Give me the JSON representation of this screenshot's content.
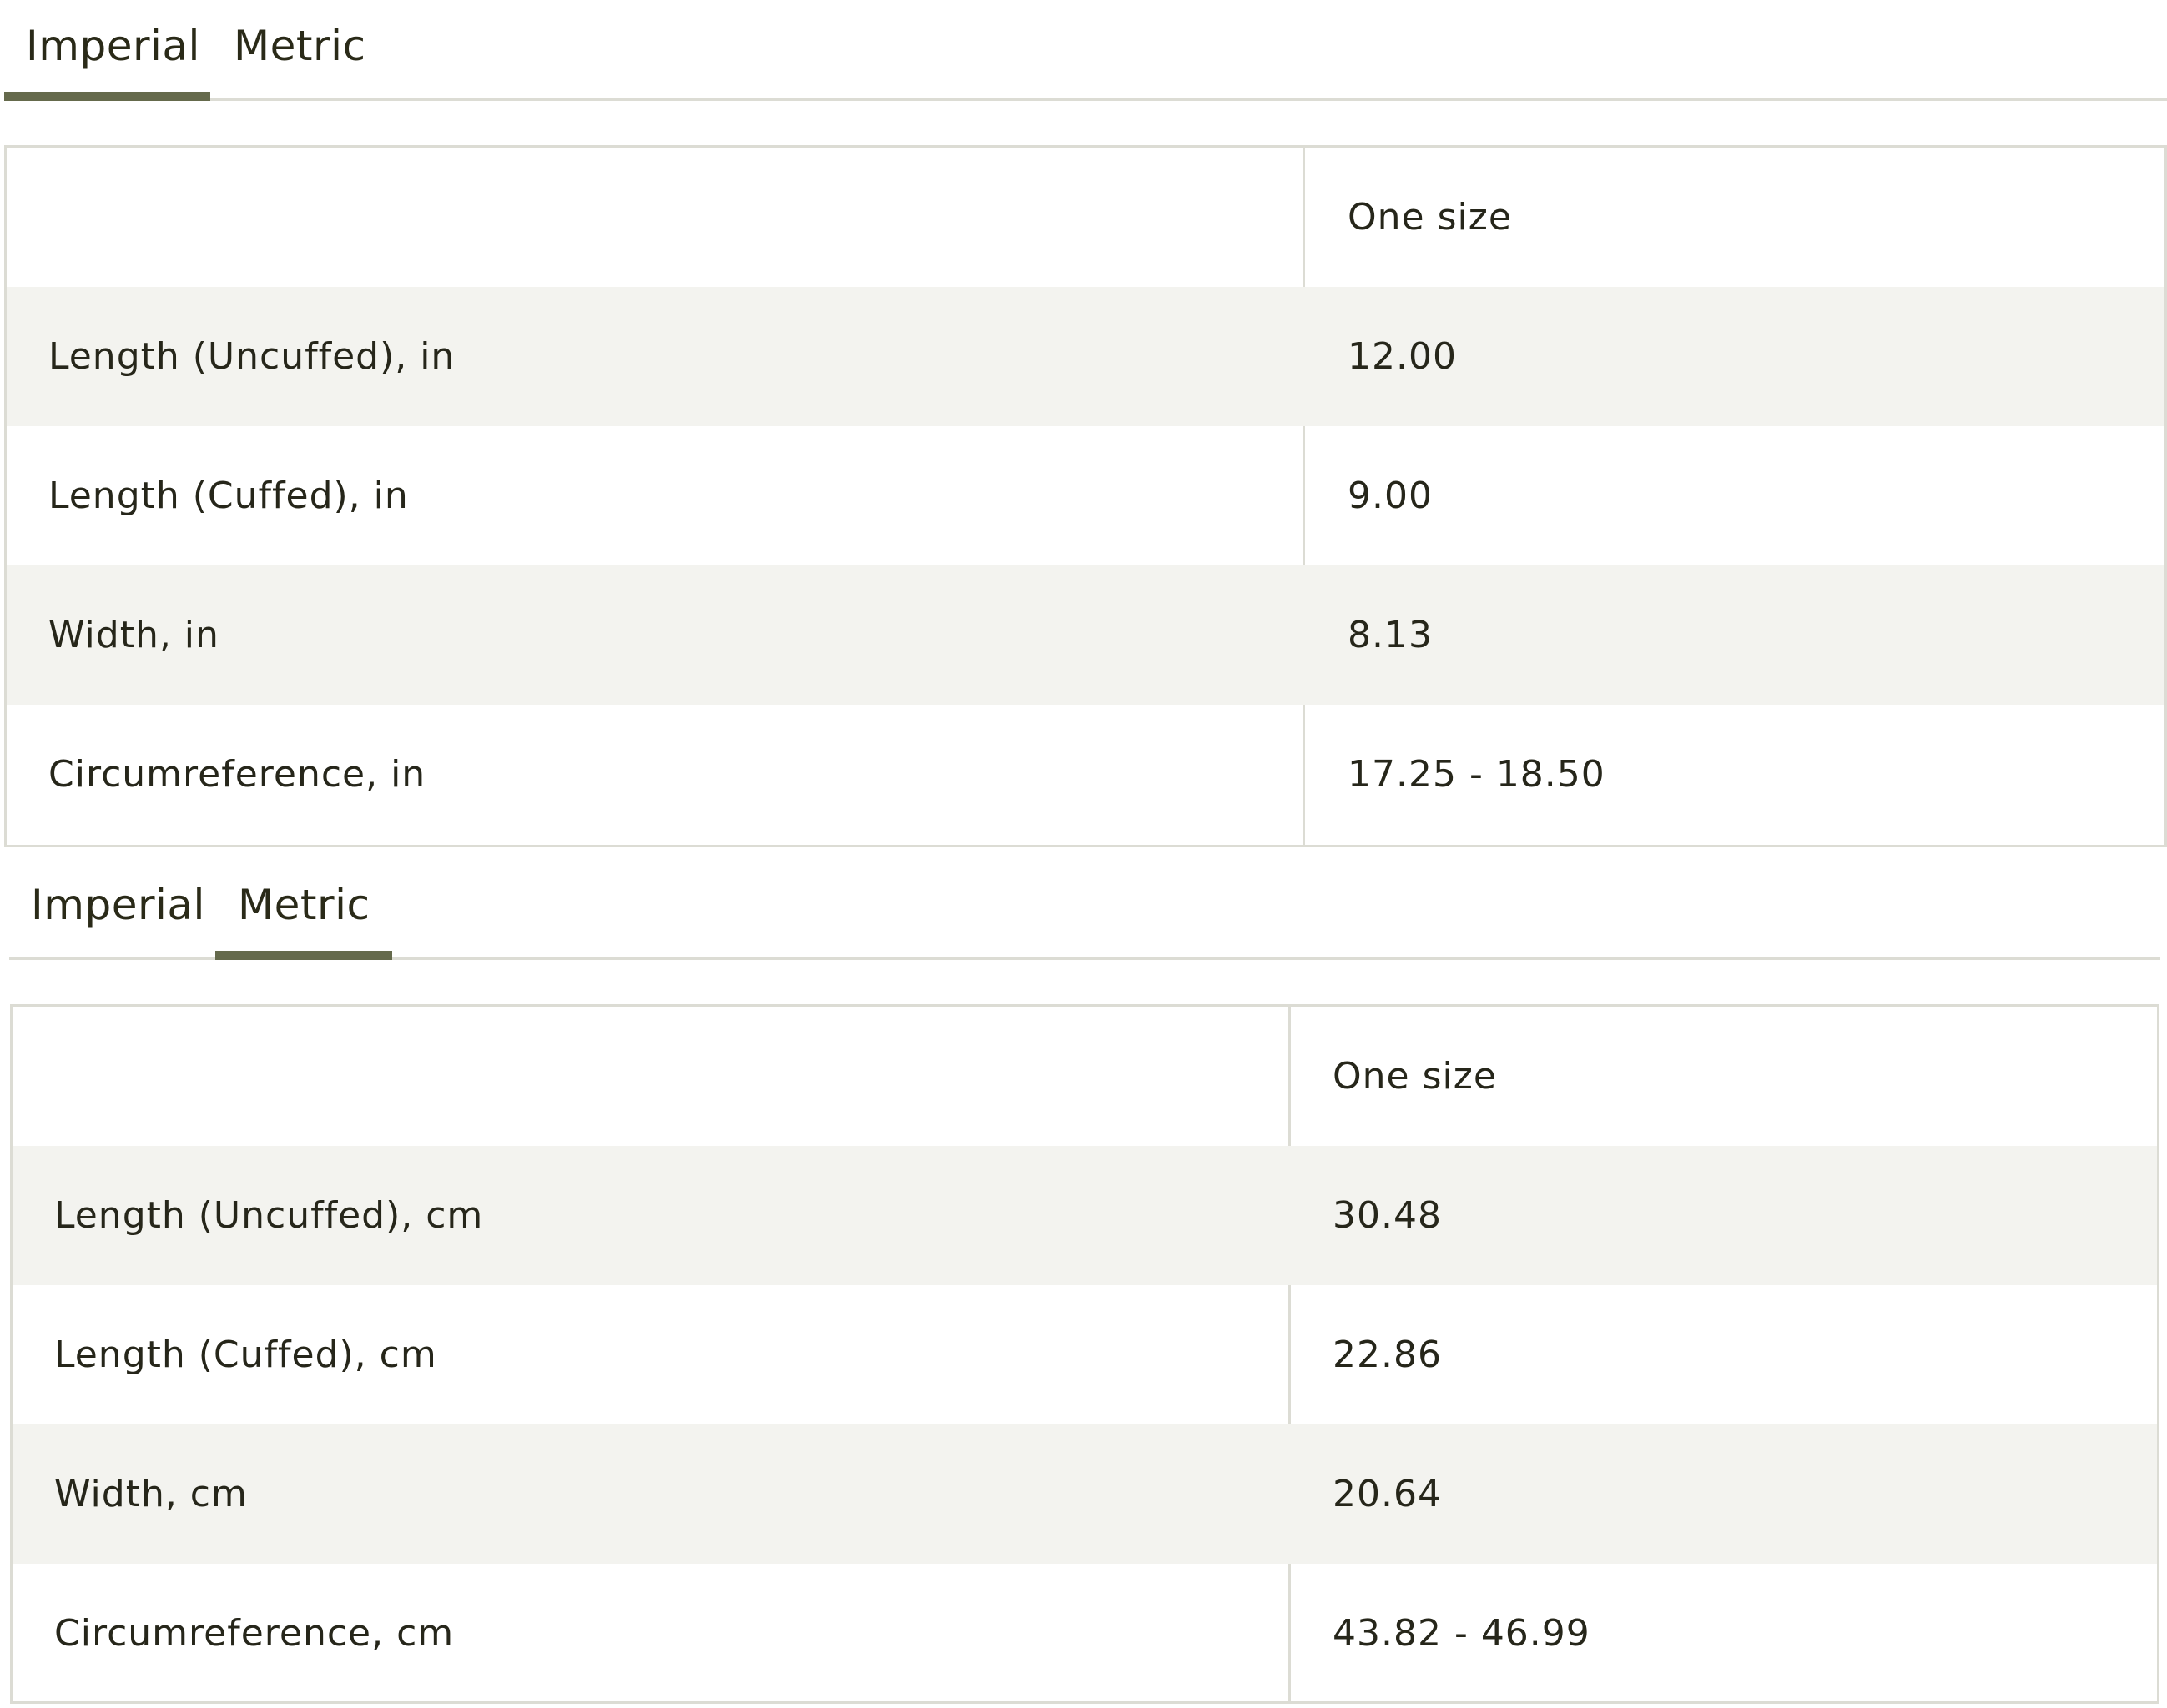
{
  "panels": [
    {
      "tabs": [
        {
          "label": "Imperial",
          "active": true
        },
        {
          "label": "Metric",
          "active": false
        }
      ],
      "table": {
        "header": {
          "label": "",
          "value": "One size"
        },
        "rows": [
          {
            "label": "Length (Uncuffed), in",
            "value": "12.00"
          },
          {
            "label": "Length (Cuffed), in",
            "value": "9.00"
          },
          {
            "label": "Width, in",
            "value": "8.13"
          },
          {
            "label": "Circumreference, in",
            "value": "17.25 - 18.50"
          }
        ]
      }
    },
    {
      "tabs": [
        {
          "label": "Imperial",
          "active": false
        },
        {
          "label": "Metric",
          "active": true
        }
      ],
      "table": {
        "header": {
          "label": "",
          "value": "One size"
        },
        "rows": [
          {
            "label": "Length (Uncuffed), cm",
            "value": "30.48"
          },
          {
            "label": "Length (Cuffed), cm",
            "value": "22.86"
          },
          {
            "label": "Width, cm",
            "value": "20.64"
          },
          {
            "label": "Circumreference, cm",
            "value": "43.82 - 46.99"
          }
        ]
      }
    }
  ],
  "colors": {
    "accent": "#656a4c",
    "border": "#dcdcd4",
    "row_shade": "#f3f3ef",
    "text": "#26261a"
  }
}
